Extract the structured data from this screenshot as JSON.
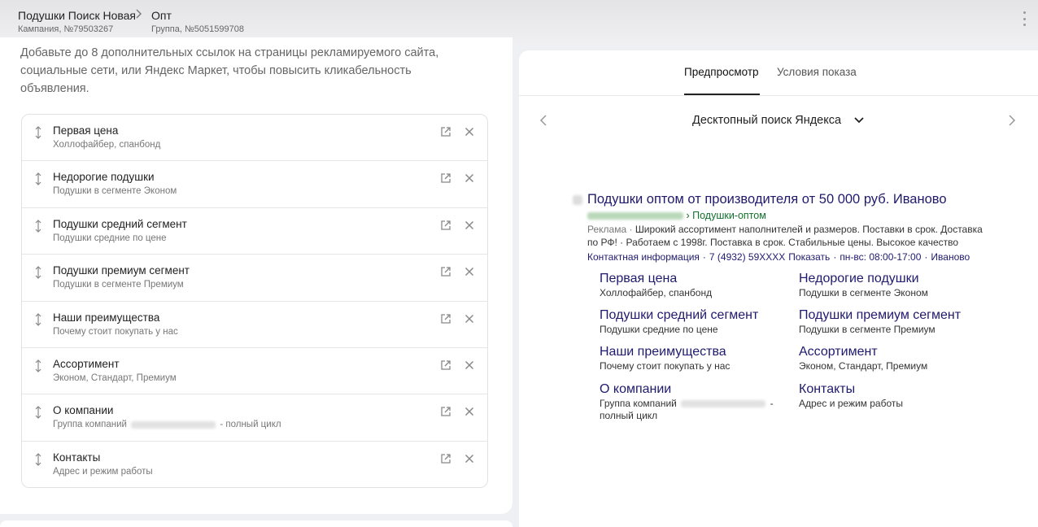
{
  "header": {
    "campaign_title": "Подушки Поиск Новая",
    "campaign_sub": "Кампания, №79503267",
    "group_title": "Опт",
    "group_sub": "Группа, №5051599708"
  },
  "left": {
    "intro": "Добавьте до 8 дополнительных ссылок на страницы рекламируемого сайта, социальные сети, или Яндекс Маркет, чтобы повысить кликабельность объявления.",
    "sitelinks": [
      {
        "title": "Первая цена",
        "desc": "Холлофайбер, спанбонд"
      },
      {
        "title": "Недорогие подушки",
        "desc": "Подушки в сегменте Эконом"
      },
      {
        "title": "Подушки средний сегмент",
        "desc": "Подушки средние по цене"
      },
      {
        "title": "Подушки премиум сегмент",
        "desc": "Подушки в сегменте Премиум"
      },
      {
        "title": "Наши преимущества",
        "desc": "Почему стоит покупать у нас"
      },
      {
        "title": "Ассортимент",
        "desc": "Эконом, Стандарт, Премиум"
      },
      {
        "title": "О компании",
        "desc_pre": "Группа компаний",
        "desc_post": "- полный цикл"
      },
      {
        "title": "Контакты",
        "desc": "Адрес и режим работы"
      }
    ]
  },
  "preview": {
    "tabs": [
      "Предпросмотр",
      "Условия показа"
    ],
    "device": "Десктопный поиск Яндекса",
    "ad": {
      "title": "Подушки оптом от производителя от 50 000 руб. Иваново",
      "url_path": "› Подушки-оптом",
      "label": "Реклама ·",
      "text": "Широкий ассортимент наполнителей и размеров. Поставки в срок. Доставка по РФ! · Работаем с 1998г. Поставка в срок. Стабильные цены. Высокое качество",
      "contacts": [
        "Контактная информация",
        "·",
        "7 (4932) 59XXXX",
        "Показать",
        "·",
        "пн-вс: 08:00-17:00",
        "·",
        "Иваново"
      ]
    },
    "sitelinks": [
      {
        "title": "Первая цена",
        "desc": "Холлофайбер, спанбонд"
      },
      {
        "title": "Недорогие подушки",
        "desc": "Подушки в сегменте Эконом"
      },
      {
        "title": "Подушки средний сегмент",
        "desc": "Подушки средние по цене"
      },
      {
        "title": "Подушки премиум сегмент",
        "desc": "Подушки в сегменте Премиум"
      },
      {
        "title": "Наши преимущества",
        "desc": "Почему стоит покупать у нас"
      },
      {
        "title": "Ассортимент",
        "desc": "Эконом, Стандарт, Премиум"
      },
      {
        "title": "О компании",
        "desc_pre": "Группа компаний",
        "desc_post": "- полный цикл"
      },
      {
        "title": "Контакты",
        "desc": "Адрес и режим работы"
      }
    ]
  },
  "colors": {
    "link": "#1f1a6e",
    "url_green": "#11702c"
  }
}
